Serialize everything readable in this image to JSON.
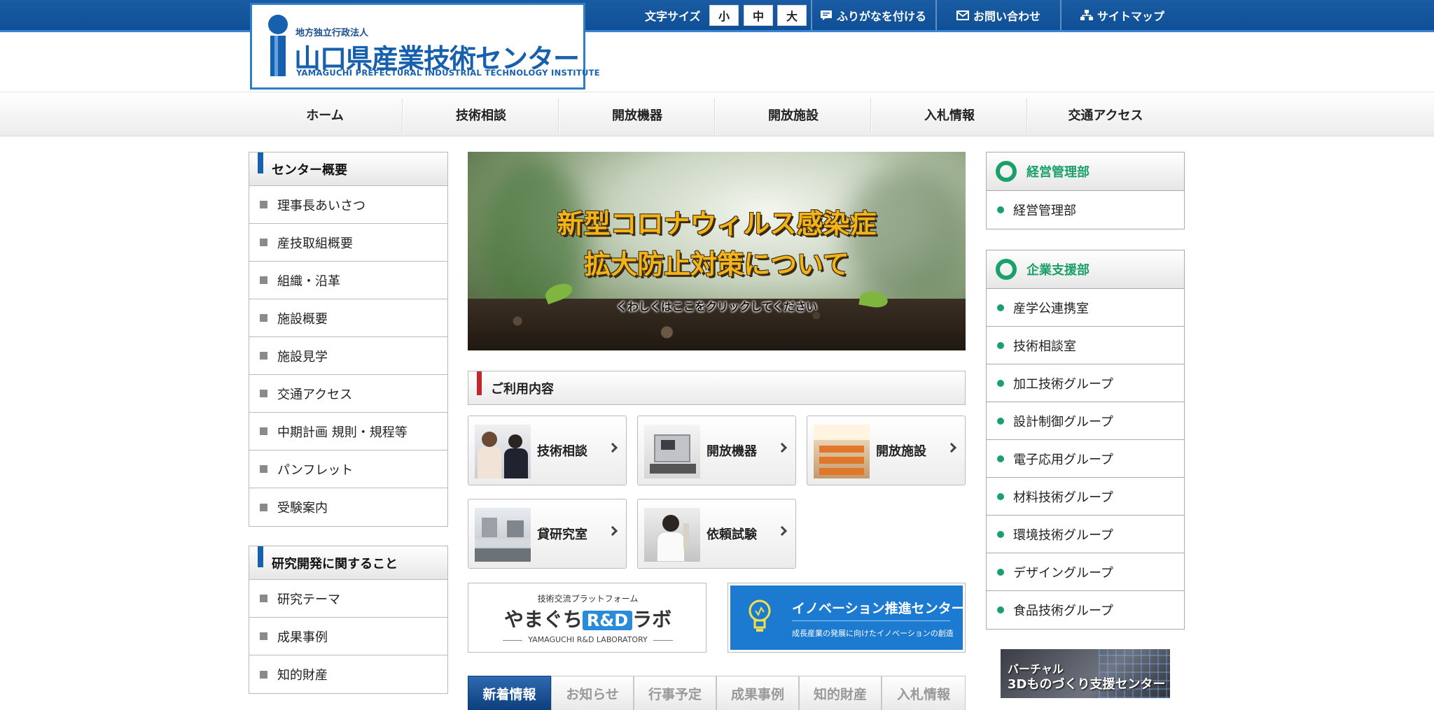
{
  "header": {
    "logo_sub": "地方独立行政法人",
    "logo_title": "山口県産業技術センター",
    "logo_en": "YAMAGUCHI PREFECTURAL INDUSTRIAL TECHNOLOGY INSTITUTE",
    "font_size_label": "文字サイズ",
    "font_sizes": [
      "小",
      "中",
      "大"
    ],
    "furigana": "ふりがなを付ける",
    "contact": "お問い合わせ",
    "sitemap": "サイトマップ"
  },
  "nav": [
    "ホーム",
    "技術相談",
    "開放機器",
    "開放施設",
    "入札情報",
    "交通アクセス"
  ],
  "left_sidebar": {
    "box1": {
      "title": "センター概要",
      "items": [
        "理事長あいさつ",
        "産技取組概要",
        "組織・沿革",
        "施設概要",
        "施設見学",
        "交通アクセス",
        "中期計画 規則・規程等",
        "パンフレット",
        "受験案内"
      ]
    },
    "box2": {
      "title": "研究開発に関すること",
      "items": [
        "研究テーマ",
        "成果事例",
        "知的財産"
      ]
    }
  },
  "hero": {
    "line1": "新型コロナウィルス感染症",
    "line2": "拡大防止対策について",
    "line3": "くわしくはここをクリックしてください"
  },
  "services": {
    "title": "ご利用内容",
    "items": [
      "技術相談",
      "開放機器",
      "開放施設",
      "貸研究室",
      "依頼試験"
    ]
  },
  "banners": {
    "rd_small": "技術交流プラットフォーム",
    "rd_main_pre": "やまぐち",
    "rd_main_tag": "R&D",
    "rd_main_post": "ラボ",
    "rd_en": "YAMAGUCHI R&D LABORATORY",
    "innovation_title": "イノベーション推進センター",
    "innovation_sub": "成長産業の発展に向けたイノベーションの創造"
  },
  "tabs": [
    "新着情報",
    "お知らせ",
    "行事予定",
    "成果事例",
    "知的財産",
    "入札情報"
  ],
  "right_sidebar": {
    "box1": {
      "title": "経営管理部",
      "items": [
        "経営管理部"
      ]
    },
    "box2": {
      "title": "企業支援部",
      "items": [
        "産学公連携室",
        "技術相談室",
        "加工技術グループ",
        "設計制御グループ",
        "電子応用グループ",
        "材料技術グループ",
        "環境技術グループ",
        "デザイングループ",
        "食品技術グループ"
      ]
    }
  },
  "virtual_banner": {
    "line1": "バーチャル",
    "line2": "3Dものづくり支援センター"
  },
  "colors": {
    "brand_blue": "#1760ae",
    "accent_green": "#1aa06a",
    "accent_red": "#c1272d"
  }
}
